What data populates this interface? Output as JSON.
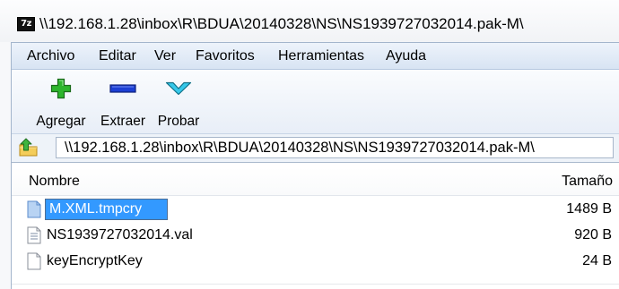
{
  "window": {
    "app_icon": "7z-icon",
    "app_icon_text": "7z",
    "title": "\\\\192.168.1.28\\inbox\\R\\BDUA\\20140328\\NS\\NS1939727032014.pak-M\\"
  },
  "menu": {
    "items": [
      "Archivo",
      "Editar",
      "Ver",
      "Favoritos",
      "Herramientas",
      "Ayuda"
    ]
  },
  "toolbar": {
    "buttons": [
      {
        "label": "Agregar",
        "icon": "add-plus-icon"
      },
      {
        "label": "Extraer",
        "icon": "extract-minus-icon"
      },
      {
        "label": "Probar",
        "icon": "test-check-icon"
      }
    ]
  },
  "address": {
    "up_icon": "folder-up-icon",
    "path": "\\\\192.168.1.28\\inbox\\R\\BDUA\\20140328\\NS\\NS1939727032014.pak-M\\"
  },
  "list": {
    "columns": {
      "name": "Nombre",
      "size": "Tamaño"
    },
    "rows": [
      {
        "name": "M.XML.tmpcry",
        "size": "1489 B",
        "icon": "file-icon",
        "selected": true,
        "editing": true
      },
      {
        "name": "NS1939727032014.val",
        "size": "920 B",
        "icon": "text-file-icon",
        "selected": false,
        "editing": false
      },
      {
        "name": "keyEncryptKey",
        "size": "24 B",
        "icon": "file-icon",
        "selected": false,
        "editing": false
      }
    ]
  },
  "colors": {
    "selection": "#3399ff",
    "selection_text": "#ffffff",
    "add_icon": "#2db52d",
    "extract_icon": "#1c3fd4",
    "test_icon": "#36c8ea",
    "menu_bar": "#d8e4f3"
  }
}
